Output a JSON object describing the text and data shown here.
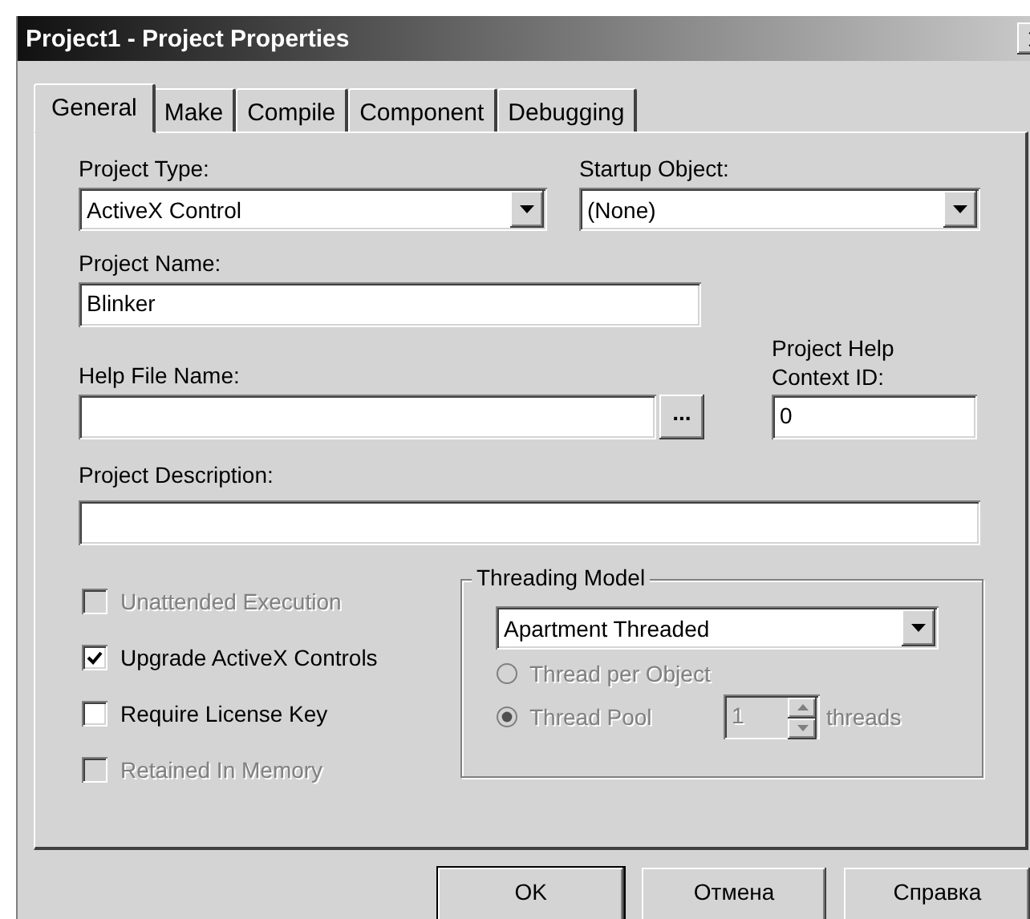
{
  "window": {
    "title": "Project1 - Project Properties"
  },
  "tabs": [
    {
      "label": "General",
      "selected": true
    },
    {
      "label": "Make",
      "selected": false
    },
    {
      "label": "Compile",
      "selected": false
    },
    {
      "label": "Component",
      "selected": false
    },
    {
      "label": "Debugging",
      "selected": false
    }
  ],
  "general": {
    "project_type": {
      "label": "Project Type:",
      "value": "ActiveX Control"
    },
    "startup_object": {
      "label": "Startup Object:",
      "value": "(None)"
    },
    "project_name": {
      "label": "Project Name:",
      "value": "Blinker"
    },
    "help_file_name": {
      "label": "Help File Name:",
      "browse": "..."
    },
    "help_context_id": {
      "label": "Project Help Context ID:",
      "value": "0"
    },
    "project_description": {
      "label": "Project Description:"
    },
    "options": [
      {
        "label": "Unattended Execution",
        "checked": false,
        "disabled": true
      },
      {
        "label": "Upgrade ActiveX Controls",
        "checked": true,
        "disabled": false
      },
      {
        "label": "Require License Key",
        "checked": false,
        "disabled": false
      },
      {
        "label": "Retained In Memory",
        "checked": false,
        "disabled": true
      }
    ],
    "threading_model": {
      "label": "Threading Model",
      "value": "Apartment Threaded",
      "options": [
        {
          "label": "Thread per Object",
          "selected": false,
          "disabled": true
        },
        {
          "label": "Thread Pool",
          "selected": true,
          "disabled": true
        }
      ],
      "thread_count": "1",
      "unit": "threads"
    }
  },
  "buttons": [
    {
      "label": "OK",
      "default": true
    },
    {
      "label": "Отмена",
      "default": false
    },
    {
      "label": "Справка",
      "default": false
    }
  ]
}
